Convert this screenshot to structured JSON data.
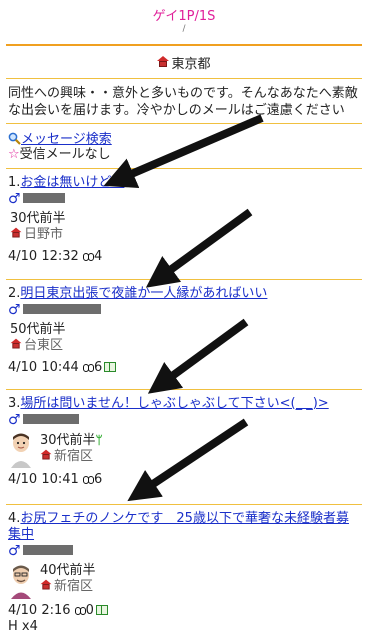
{
  "header": {
    "site_title": "ゲイ1P/1S",
    "slash": "/"
  },
  "region": {
    "name": "東京都"
  },
  "intro": {
    "text": "同性への興味・・意外と多いものです。そんなあなたへ素敵な出会いを届けます。冷やかしのメールはご遠慮ください"
  },
  "links": {
    "search": "メッセージ検索",
    "inbox": "受信メールなし",
    "inbox_star": "☆"
  },
  "male_symbol": "♂",
  "posts": [
    {
      "number": "1.",
      "title": "お金は無いけど…",
      "age": "30代前半",
      "location": "日野市",
      "datetime": "4/10 12:32",
      "count": "4"
    },
    {
      "number": "2.",
      "title": "明日東京出張で夜誰か一人縁があればいい",
      "age": "50代前半",
      "location": "台東区",
      "datetime": "4/10 10:44",
      "count": "6"
    },
    {
      "number": "3.",
      "title": "場所は問いません！しゃぶしゃぶして下さい<(_ _)>",
      "age": "30代前半",
      "location": "新宿区",
      "datetime": "4/10 10:41",
      "count": "6"
    },
    {
      "number": "4.",
      "title": "お尻フェチのノンケです　25歳以下で華奢な未経験者募集中",
      "age": "40代前半",
      "location": "新宿区",
      "datetime": "4/10 2:16",
      "count": "0"
    }
  ],
  "footer": {
    "text": "H x4"
  }
}
